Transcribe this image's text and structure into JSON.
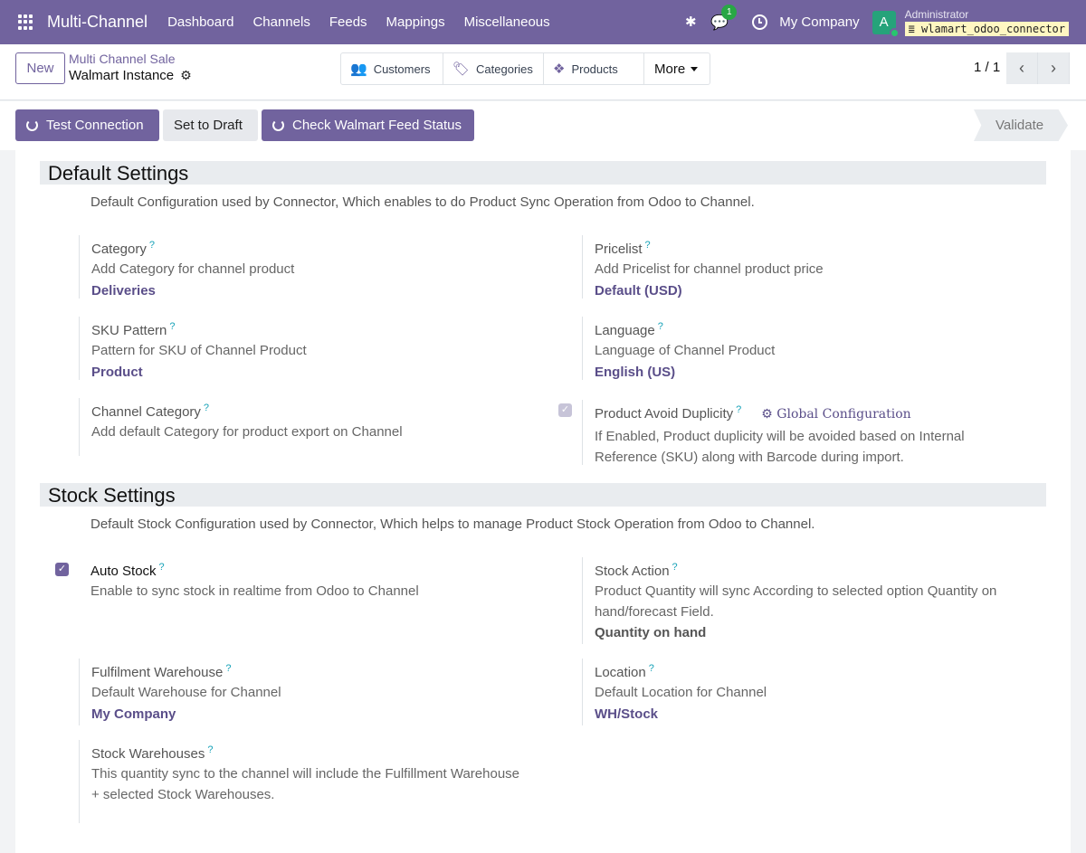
{
  "navbar": {
    "brand": "Multi-Channel",
    "menu": [
      "Dashboard",
      "Channels",
      "Feeds",
      "Mappings",
      "Miscellaneous"
    ],
    "chat_count": "1",
    "company": "My Company",
    "avatar_letter": "A",
    "user": "Administrator",
    "database": "wlamart_odoo_connector"
  },
  "control": {
    "new_label": "New",
    "breadcrumb": "Multi Channel Sale",
    "record_title": "Walmart Instance",
    "smart_buttons": {
      "customers": "Customers",
      "categories": "Categories",
      "products": "Products",
      "more": "More"
    },
    "pager": "1 / 1"
  },
  "statusbar": {
    "test_connection": "Test Connection",
    "set_to_draft": "Set to Draft",
    "check_feed": "Check Walmart Feed Status",
    "stage": "Validate"
  },
  "default_settings": {
    "title": "Default Settings",
    "description": "Default Configuration used by Connector, Which enables to do Product Sync Operation from Odoo to Channel.",
    "category": {
      "label": "Category",
      "help": "?",
      "desc": "Add Category for channel product",
      "value": "Deliveries"
    },
    "pricelist": {
      "label": "Pricelist",
      "help": "?",
      "desc": "Add Pricelist for channel product price",
      "value": "Default (USD)"
    },
    "sku_pattern": {
      "label": "SKU Pattern",
      "help": "?",
      "desc": "Pattern for SKU of Channel Product",
      "value": "Product"
    },
    "language": {
      "label": "Language",
      "help": "?",
      "desc": "Language of Channel Product",
      "value": "English (US)"
    },
    "channel_category": {
      "label": "Channel Category",
      "help": "?",
      "desc": "Add default Category for product export on Channel"
    },
    "avoid_duplicity": {
      "label": "Product Avoid Duplicity",
      "help": "?",
      "link": "Global Configuration",
      "desc_1": "If Enabled, Product duplicity will be avoided based on Internal",
      "desc_2": "Reference (SKU) along with Barcode during import.",
      "checked": true
    }
  },
  "stock_settings": {
    "title": "Stock Settings",
    "description": "Default Stock Configuration used by Connector, Which helps to manage Product Stock Operation from Odoo to Channel.",
    "auto_stock": {
      "label": "Auto Stock",
      "help": "?",
      "desc": "Enable to sync stock in realtime from Odoo to Channel",
      "checked": true
    },
    "stock_action": {
      "label": "Stock Action",
      "help": "?",
      "desc_1": "Product Quantity will sync According to selected option Quantity on",
      "desc_2": "hand/forecast Field.",
      "value": "Quantity on hand"
    },
    "fulfilment_warehouse": {
      "label": "Fulfilment Warehouse",
      "help": "?",
      "desc": "Default Warehouse for Channel",
      "value": "My Company"
    },
    "location": {
      "label": "Location",
      "help": "?",
      "desc": "Default Location for Channel",
      "value": "WH/Stock"
    },
    "stock_warehouses": {
      "label": "Stock Warehouses",
      "help": "?",
      "desc_1": "This quantity sync to the channel will include the Fulfillment Warehouse",
      "desc_2": "+ selected Stock Warehouses."
    }
  },
  "colors": {
    "brand": "#71639e",
    "value_text": "#5a4e89",
    "success": "#28a745"
  },
  "icons": [
    "apps-grid-icon",
    "bug-icon",
    "chat-icon",
    "clock-icon",
    "gear-icon",
    "users-icon",
    "tag-icon",
    "dropbox-icon",
    "chevron-left-icon",
    "chevron-right-icon",
    "refresh-icon",
    "check-icon"
  ]
}
